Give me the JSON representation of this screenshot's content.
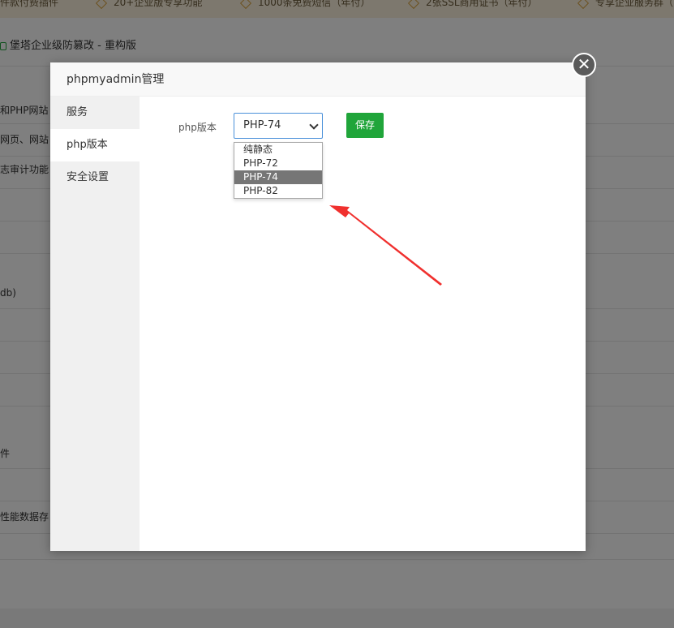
{
  "promo": {
    "items": [
      "件款付费插件",
      "20+企业版专享功能",
      "1000条免费短信（年付）",
      "2张SSL商用证书（年付）",
      "专享企业服务群（"
    ]
  },
  "background": {
    "site_title": "堡塔企业级防篡改 - 重构版",
    "rows": [
      "和PHP网站",
      "网页、网站",
      "志审计功能",
      "db)",
      "件",
      "性能数据存"
    ]
  },
  "modal": {
    "title": "phpmyadmin管理",
    "close_symbol": "✕",
    "sidebar": {
      "items": [
        {
          "label": "服务"
        },
        {
          "label": "php版本"
        },
        {
          "label": "安全设置"
        }
      ]
    },
    "form": {
      "php_label": "php版本",
      "selected_value": "PHP-74",
      "options": [
        "纯静态",
        "PHP-72",
        "PHP-74",
        "PHP-82"
      ],
      "save_label": "保存"
    }
  },
  "colors": {
    "accent_green": "#20a53a",
    "select_border": "#4a90d9",
    "selected_option_bg": "#767676",
    "annotation_arrow": "#f0302e"
  }
}
